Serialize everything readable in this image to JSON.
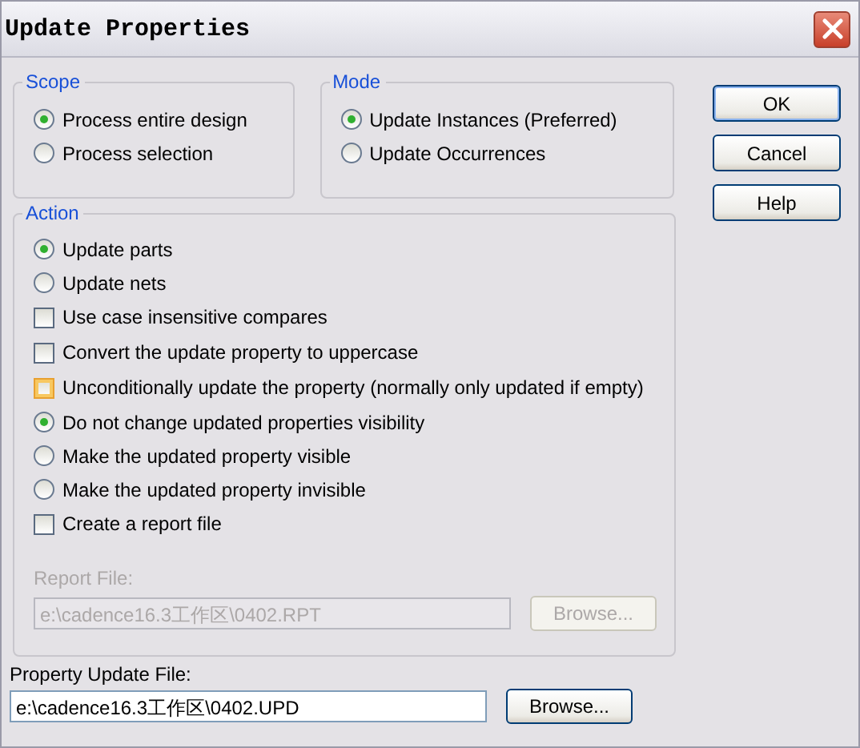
{
  "window": {
    "title": "Update Properties"
  },
  "scope": {
    "label": "Scope",
    "options": [
      {
        "label": "Process entire design",
        "selected": true
      },
      {
        "label": "Process selection",
        "selected": false
      }
    ]
  },
  "mode": {
    "label": "Mode",
    "options": [
      {
        "label": "Update Instances (Preferred)",
        "selected": true
      },
      {
        "label": "Update Occurrences",
        "selected": false
      }
    ]
  },
  "action": {
    "label": "Action",
    "items": [
      {
        "kind": "radio",
        "label": "Update parts",
        "selected": true
      },
      {
        "kind": "radio",
        "label": "Update nets",
        "selected": false
      },
      {
        "kind": "checkbox",
        "label": "Use case insensitive compares",
        "checked": false,
        "hovered": false
      },
      {
        "kind": "checkbox",
        "label": "Convert the update property to uppercase",
        "checked": false,
        "hovered": false
      },
      {
        "kind": "checkbox",
        "label": "Unconditionally update the property (normally only updated if empty)",
        "checked": false,
        "hovered": true
      },
      {
        "kind": "radio",
        "label": "Do not change updated properties visibility",
        "selected": true
      },
      {
        "kind": "radio",
        "label": "Make the updated property visible",
        "selected": false
      },
      {
        "kind": "radio",
        "label": "Make the updated property invisible",
        "selected": false
      },
      {
        "kind": "checkbox",
        "label": "Create a report file",
        "checked": false,
        "hovered": false
      }
    ]
  },
  "report_file": {
    "label": "Report File:",
    "value": "e:\\cadence16.3工作区\\0402.RPT",
    "browse": "Browse...",
    "disabled": true
  },
  "property_update_file": {
    "label": "Property Update File:",
    "value": "e:\\cadence16.3工作区\\0402.UPD",
    "browse": "Browse..."
  },
  "buttons": [
    {
      "label": "OK",
      "default": true
    },
    {
      "label": "Cancel",
      "default": false
    },
    {
      "label": "Help",
      "default": false
    }
  ]
}
